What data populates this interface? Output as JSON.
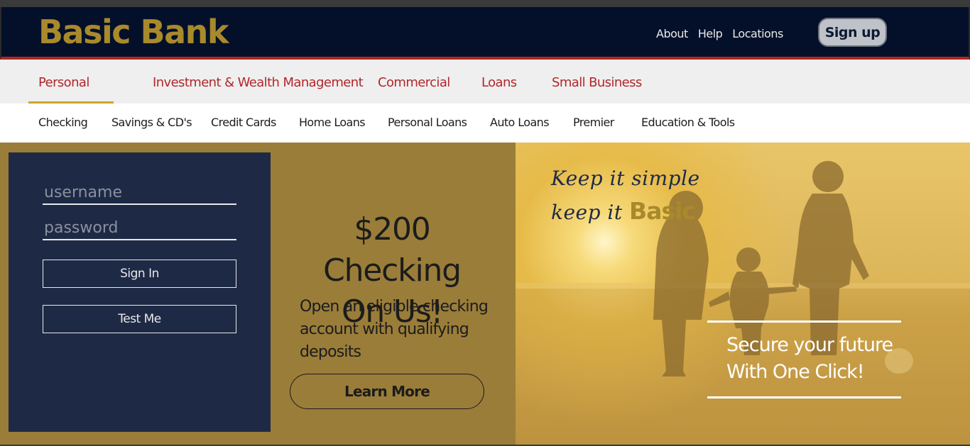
{
  "header": {
    "logo_text": "Basic Bank",
    "links": [
      "About",
      "Help",
      "Locations"
    ],
    "signup_label": "Sign up"
  },
  "nav_primary": {
    "tabs": [
      "Personal",
      "Investment & Wealth Management",
      "Commercial",
      "Loans",
      "Small Business"
    ],
    "active": "Personal"
  },
  "nav_secondary": {
    "items": [
      "Checking",
      "Savings & CD's",
      "Credit Cards",
      "Home Loans",
      "Personal Loans",
      "Auto Loans",
      "Premier",
      "Education & Tools"
    ]
  },
  "login": {
    "username_placeholder": "username",
    "password_placeholder": "password",
    "signin_label": "Sign In",
    "testme_label": "Test Me"
  },
  "promo": {
    "title_line1": "$200 Checking",
    "title_line2": "On Us!",
    "description": "Open an eligible checking account with qualifying deposits",
    "button_label": "Learn More"
  },
  "hero_image": {
    "tagline_line1": "Keep it simple",
    "tagline_line2_prefix": "keep it ",
    "tagline_brand": "Basic",
    "secure_line1": "Secure your future",
    "secure_line2": "With One Click!"
  },
  "colors": {
    "navy": "#04102a",
    "gold": "#a88a2c",
    "red_accent": "#b2262b",
    "hero_bg": "#9a7d39",
    "panel_bg": "#1e2a45"
  }
}
